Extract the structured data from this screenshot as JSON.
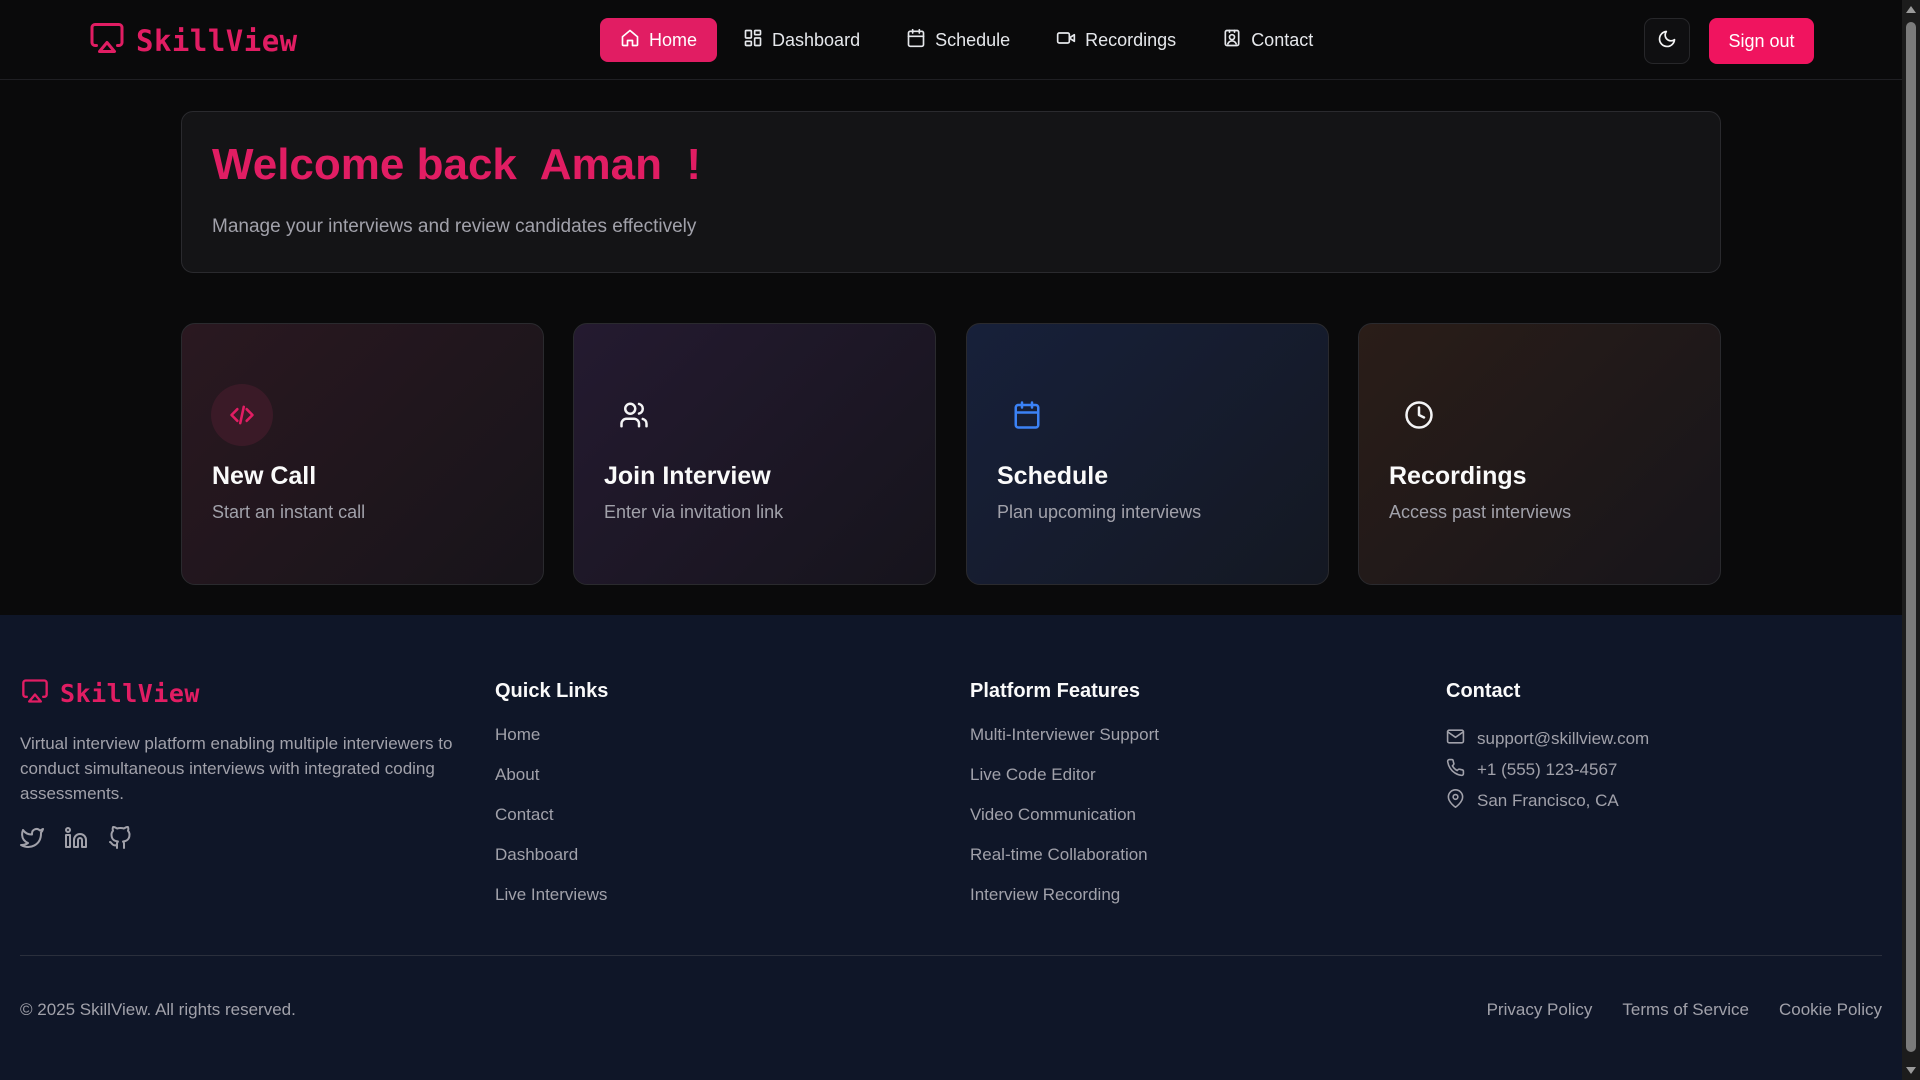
{
  "brand": {
    "name": "SkillView",
    "accent": "#e11d63"
  },
  "nav": {
    "items": [
      {
        "label": "Home",
        "icon": "home-icon",
        "active": true
      },
      {
        "label": "Dashboard",
        "icon": "dashboard-icon"
      },
      {
        "label": "Schedule",
        "icon": "calendar-icon"
      },
      {
        "label": "Recordings",
        "icon": "video-icon"
      },
      {
        "label": "Contact",
        "icon": "contact-icon"
      }
    ],
    "theme_icon": "moon-icon",
    "signout_label": "Sign out"
  },
  "welcome": {
    "title": "Welcome back  Aman  !",
    "subtitle": "Manage your interviews and review candidates effectively"
  },
  "cards": [
    {
      "title": "New Call",
      "desc": "Start an instant call",
      "icon": "code-icon"
    },
    {
      "title": "Join Interview",
      "desc": "Enter via invitation link",
      "icon": "users-icon"
    },
    {
      "title": "Schedule",
      "desc": "Plan upcoming interviews",
      "icon": "calendar-icon"
    },
    {
      "title": "Recordings",
      "desc": "Access past interviews",
      "icon": "clock-icon"
    }
  ],
  "footer": {
    "brand": "SkillView",
    "description": "Virtual interview platform enabling multiple interviewers to conduct simultaneous interviews with integrated coding assessments.",
    "social": [
      "twitter-icon",
      "linkedin-icon",
      "github-icon"
    ],
    "quick_links": {
      "heading": "Quick Links",
      "items": [
        "Home",
        "About",
        "Contact",
        "Dashboard",
        "Live Interviews"
      ]
    },
    "features": {
      "heading": "Platform Features",
      "items": [
        "Multi-Interviewer Support",
        "Live Code Editor",
        "Video Communication",
        "Real-time Collaboration",
        "Interview Recording"
      ]
    },
    "contact": {
      "heading": "Contact",
      "email": "support@skillview.com",
      "phone": "+1 (555) 123-4567",
      "location": "San Francisco, CA"
    },
    "copyright": "© 2025 SkillView. All rights reserved.",
    "legal": [
      "Privacy Policy",
      "Terms of Service",
      "Cookie Policy"
    ]
  }
}
